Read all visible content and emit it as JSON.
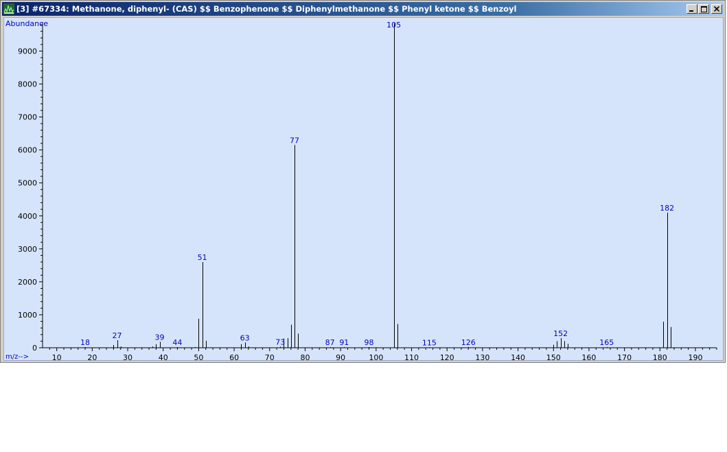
{
  "window": {
    "title": "[3] #67334: Methanone, diphenyl- (CAS) $$ Benzophenone $$ Diphenylmethanone $$ Phenyl ketone $$ Benzoyl",
    "icons": [
      "spectrum-app-icon",
      "minimize-icon",
      "maximize-icon",
      "close-icon"
    ],
    "titlebar_color": "#0a246a"
  },
  "chart_data": {
    "type": "bar",
    "ylabel": "Abundance",
    "xlabel": "m/z-->",
    "xlim": [
      6,
      196
    ],
    "ylim": [
      0,
      9800
    ],
    "x_ticks": [
      10,
      20,
      30,
      40,
      50,
      60,
      70,
      80,
      90,
      100,
      110,
      120,
      130,
      140,
      150,
      160,
      170,
      180,
      190
    ],
    "y_ticks": [
      0,
      1000,
      2000,
      3000,
      4000,
      5000,
      6000,
      7000,
      8000,
      9000
    ],
    "colors": {
      "background": "#d6e4fb",
      "peak": "#000000",
      "label": "#0000c0"
    },
    "peaks": [
      {
        "mz": 18,
        "abundance": 20
      },
      {
        "mz": 26,
        "abundance": 80
      },
      {
        "mz": 27,
        "abundance": 230
      },
      {
        "mz": 28,
        "abundance": 40
      },
      {
        "mz": 37,
        "abundance": 40
      },
      {
        "mz": 38,
        "abundance": 110
      },
      {
        "mz": 39,
        "abundance": 180
      },
      {
        "mz": 44,
        "abundance": 20
      },
      {
        "mz": 49,
        "abundance": 20
      },
      {
        "mz": 50,
        "abundance": 880
      },
      {
        "mz": 51,
        "abundance": 2600
      },
      {
        "mz": 52,
        "abundance": 210
      },
      {
        "mz": 62,
        "abundance": 110
      },
      {
        "mz": 63,
        "abundance": 160
      },
      {
        "mz": 64,
        "abundance": 40
      },
      {
        "mz": 73,
        "abundance": 30
      },
      {
        "mz": 74,
        "abundance": 280
      },
      {
        "mz": 75,
        "abundance": 290
      },
      {
        "mz": 76,
        "abundance": 700
      },
      {
        "mz": 77,
        "abundance": 6150
      },
      {
        "mz": 78,
        "abundance": 430
      },
      {
        "mz": 87,
        "abundance": 20
      },
      {
        "mz": 91,
        "abundance": 20
      },
      {
        "mz": 98,
        "abundance": 20
      },
      {
        "mz": 105,
        "abundance": 10000
      },
      {
        "mz": 106,
        "abundance": 720
      },
      {
        "mz": 115,
        "abundance": 15
      },
      {
        "mz": 126,
        "abundance": 20
      },
      {
        "mz": 150,
        "abundance": 90
      },
      {
        "mz": 151,
        "abundance": 200
      },
      {
        "mz": 152,
        "abundance": 290
      },
      {
        "mz": 153,
        "abundance": 200
      },
      {
        "mz": 154,
        "abundance": 120
      },
      {
        "mz": 165,
        "abundance": 20
      },
      {
        "mz": 181,
        "abundance": 790
      },
      {
        "mz": 182,
        "abundance": 4100
      },
      {
        "mz": 183,
        "abundance": 630
      }
    ],
    "annotations": [
      {
        "text": "18",
        "mz": 18,
        "abundance": 20
      },
      {
        "text": "27",
        "mz": 27,
        "abundance": 230
      },
      {
        "text": "39",
        "mz": 39,
        "abundance": 180
      },
      {
        "text": "44",
        "mz": 44,
        "abundance": 20
      },
      {
        "text": "51",
        "mz": 51,
        "abundance": 2600
      },
      {
        "text": "63",
        "mz": 63,
        "abundance": 160
      },
      {
        "text": "73",
        "mz": 73,
        "abundance": 30
      },
      {
        "text": "77",
        "mz": 77,
        "abundance": 6150
      },
      {
        "text": "87",
        "mz": 87,
        "abundance": 20
      },
      {
        "text": "91",
        "mz": 91,
        "abundance": 20
      },
      {
        "text": "98",
        "mz": 98,
        "abundance": 20
      },
      {
        "text": "105",
        "mz": 105,
        "abundance": 10000
      },
      {
        "text": "115",
        "mz": 115,
        "abundance": 15
      },
      {
        "text": "126",
        "mz": 126,
        "abundance": 20
      },
      {
        "text": "152",
        "mz": 152,
        "abundance": 290
      },
      {
        "text": "165",
        "mz": 165,
        "abundance": 20
      },
      {
        "text": "182",
        "mz": 182,
        "abundance": 4100
      }
    ]
  }
}
